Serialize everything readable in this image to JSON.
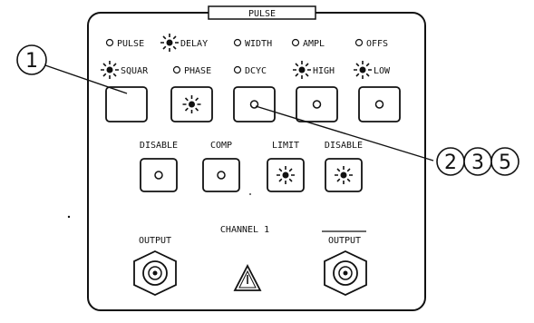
{
  "panel": {
    "title": "PULSE"
  },
  "indicators_row1": [
    {
      "label": "PULSE",
      "lit": false
    },
    {
      "label": "DELAY",
      "lit": true
    },
    {
      "label": "WIDTH",
      "lit": false
    },
    {
      "label": "AMPL",
      "lit": false
    },
    {
      "label": "OFFS",
      "lit": false
    }
  ],
  "indicators_row2": [
    {
      "label": "SQUAR",
      "lit": true
    },
    {
      "label": "PHASE",
      "lit": false
    },
    {
      "label": "DCYC",
      "lit": false
    },
    {
      "label": "HIGH",
      "lit": true
    },
    {
      "label": "LOW",
      "lit": true
    }
  ],
  "buttons_row1": [
    {
      "lamp": "none"
    },
    {
      "lamp": "lit"
    },
    {
      "lamp": "off"
    },
    {
      "lamp": "off"
    },
    {
      "lamp": "off"
    }
  ],
  "buttons_row2": [
    {
      "label": "DISABLE",
      "lamp": "off"
    },
    {
      "label": "COMP",
      "lamp": "off"
    },
    {
      "label": "LIMIT",
      "lamp": "lit"
    },
    {
      "label": "DISABLE",
      "lamp": "lit"
    }
  ],
  "channel": {
    "label": "CHANNEL 1"
  },
  "outputs": {
    "normal": "OUTPUT",
    "inverted": "OUTPUT"
  },
  "callouts": {
    "left": "1",
    "right": [
      "2",
      "3",
      "5"
    ]
  }
}
